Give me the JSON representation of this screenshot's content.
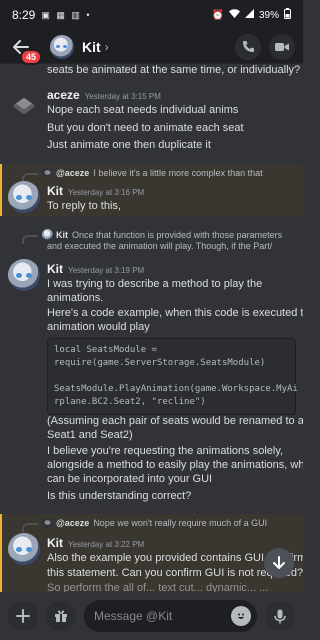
{
  "status_bar": {
    "time": "8:29",
    "battery": "39%"
  },
  "header": {
    "badge_count": "45",
    "name": "Kit"
  },
  "messages": {
    "cut_line": "seats be animated at the same time, or individually?",
    "g1": {
      "author": "aceze",
      "timestamp": "Yesterday at 3:15 PM",
      "lines": [
        "Nope each seat needs individual anims",
        "But you don't need to animate each seat",
        "Just animate one then duplicate it"
      ]
    },
    "g2": {
      "reply_author": "@aceze",
      "reply_text": "I believe it's a little more complex than that",
      "author": "Kit",
      "timestamp": "Yesterday at 3:16 PM",
      "lines": [
        "To reply to this,"
      ]
    },
    "g3": {
      "reply_author": "Kit",
      "reply_text": "Once that function is provided with those parameters",
      "reply_text2": "and executed the animation will play. Though, if the Part/",
      "author": "Kit",
      "timestamp": "Yesterday at 3:19 PM",
      "lines_a": [
        "I was trying to describe a method to play the",
        "animations.",
        "Here's a code example, when this code is executed the",
        "animation would play"
      ],
      "code": [
        "local SeatsModule =",
        "require(game.ServerStorage.SeatsModule)",
        "",
        "SeatsModule.PlayAnimation(game.Workspace.MyAi",
        "rplane.BC2.Seat2, \"recline\")"
      ],
      "lines_b": [
        "(Assuming each pair of seats would be renamed to a",
        "Seat1 and Seat2)",
        "I believe you're requesting the animations solely,",
        "alongside a method to easily play the animations, which",
        "can be incorporated into your GUI",
        "Is this understanding correct?"
      ]
    },
    "g4": {
      "reply_author": "@aceze",
      "reply_text": "Nope we won't really require much of a GUI",
      "author": "Kit",
      "timestamp": "Yesterday at 3:22 PM",
      "lines": [
        "Also the example you provided contains GUI, confirming",
        "this statement. Can you confirm GUI is not required?",
        "So perform the all of... text cut... dynamic... ..."
      ]
    }
  },
  "composer": {
    "placeholder": "Message @Kit"
  },
  "colors": {
    "background": "#313338",
    "highlight_bar": "#f0b232",
    "badge": "#f23f43"
  }
}
